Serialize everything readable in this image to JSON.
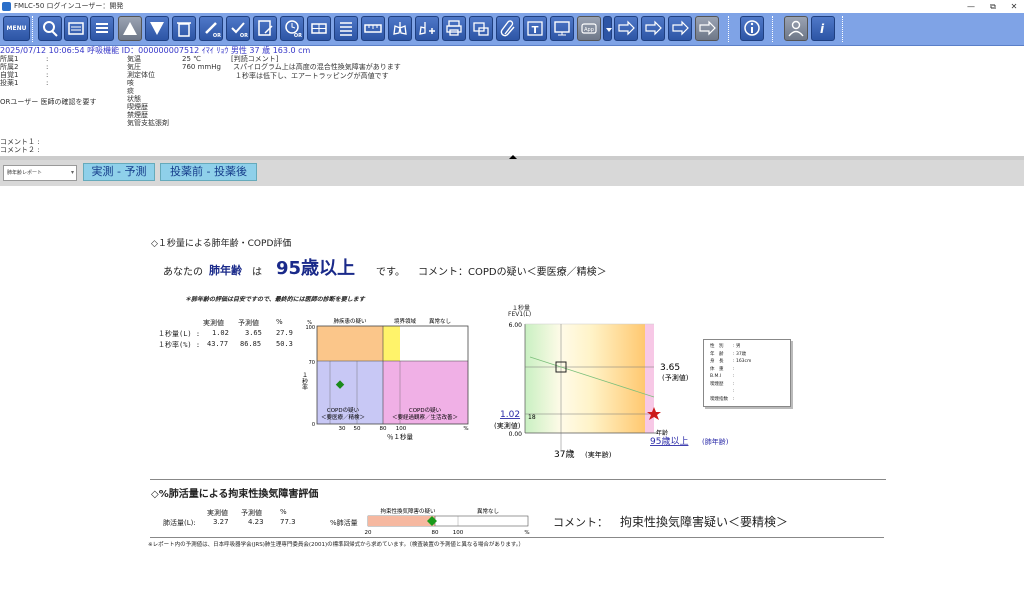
{
  "window": {
    "title": "FMLC-50 ログインユーザー：開発",
    "minimize": "—",
    "restore": "⧉",
    "close": "✕"
  },
  "toolbar": {
    "menu_label": "MENU"
  },
  "patient": {
    "infoline": "2025/07/12 10:06:54 呼吸機能 ID：000000007512 ｲﾏｲ ﾘｮｳ 男性 37 歳 163.0 cm",
    "left_labels": [
      "所属1",
      "所属2",
      "自覚1",
      "投薬1"
    ],
    "left_colons": [
      ":",
      ":",
      ":",
      ":"
    ],
    "or_user": "ORユーザー 医師の確認を要す",
    "mid_labels": [
      "気温",
      "気圧",
      "測定体位",
      "咳",
      "痰",
      "状態",
      "喫煙歴",
      "禁煙歴",
      "気管支拡張剤"
    ],
    "temp": "25 ℃",
    "pressure": "760 mmHg",
    "judge_title": "[判読コメント]",
    "judge_line1": "スパイログラム上は高度の混合性換気障害があります",
    "judge_line2": "１秒率は低下し、エアートラッピングが高値です",
    "comment1": "コメント１ :",
    "comment2": "コメント２ :"
  },
  "tabs": {
    "report_select": "肺年齢レポート",
    "tab1": "実測 - 予測",
    "tab2": "投薬前 - 投薬後"
  },
  "report": {
    "section1_title": "◇１秒量による肺年齢・COPD評価",
    "lung_age_prefix": "あなたの",
    "lung_age_label": "肺年齢",
    "lung_age_ha": "は",
    "lung_age_value": "95歳以上",
    "lung_age_suffix": "です。",
    "lung_age_comment": "コメント：COPDの疑い＜要医療／精検＞",
    "note": "＊肺年齢の評価は目安ですので、最終的には医師の診断を要します",
    "table_headers": [
      "実測値",
      "予測値",
      "%"
    ],
    "table_rows": [
      {
        "label": "１秒量(L) :",
        "values": [
          "1.02",
          "3.65",
          "27.9"
        ]
      },
      {
        "label": "１秒率(%) :",
        "values": [
          "43.77",
          "86.85",
          "50.3"
        ]
      }
    ],
    "quad": {
      "y_axis_title": "１秒率",
      "y_axis_unit": "%",
      "y_ticks": [
        "100",
        "70",
        "0"
      ],
      "x_ticks": [
        "30",
        "50",
        "80",
        "100",
        "%"
      ],
      "x_title": "％１秒量",
      "top_labels": [
        "肺疾患の疑い",
        "境界領域",
        "異常なし"
      ],
      "q_low_left": [
        "COPDの疑い",
        "＜要医療／精検＞"
      ],
      "q_low_right": [
        "COPDの疑い",
        "＜要経過観察／生活改善＞"
      ],
      "colors": {
        "orange": "#fbc68a",
        "yellow": "#fff36a",
        "blue": "#c8c8f5",
        "pink": "#f0b0e6"
      },
      "point": {
        "pct_fev1": 27.9,
        "fev1_ratio": 43.77
      }
    },
    "age_chart": {
      "y_title": "１秒量",
      "y_unit": "FEV1(L)",
      "y_top": "6.00",
      "y_bottom": "0.00",
      "pred_value": "3.65",
      "pred_label": "(予測値)",
      "meas_value": "1.02",
      "meas_label": "(実測値)",
      "age_label": "年齢",
      "lung_age_text": "95歳以上",
      "lung_age_suffix": "(肺年齢)",
      "real_age": "37歳",
      "real_age_suffix": "(実年齢)",
      "tick_value": "18"
    },
    "profile": {
      "rows": [
        {
          "k": "性　別",
          "v": "男"
        },
        {
          "k": "年　齢",
          "v": "37歳"
        },
        {
          "k": "身　長",
          "v": "163cm"
        },
        {
          "k": "体　重",
          "v": ""
        },
        {
          "k": "B.M.I",
          "v": ""
        },
        {
          "k": "喫煙歴",
          "v": ""
        },
        {
          "k": "",
          "v": ""
        },
        {
          "k": "喫煙指数",
          "v": ""
        }
      ]
    },
    "section2_title": "◇%肺活量による拘束性換気障害評価",
    "vc_headers": [
      "実測値",
      "予測値",
      "%"
    ],
    "vc_row_label": "肺活量(L):",
    "vc_values": [
      "3.27",
      "4.23",
      "77.3"
    ],
    "vc_bar_label": "%肺活量",
    "vc_top_labels": [
      "拘束性換気障害の疑い",
      "異常なし"
    ],
    "vc_ticks": [
      "20",
      "80",
      "100",
      "%"
    ],
    "vc_point": 77.3,
    "vc_comment_prefix": "コメント：",
    "vc_comment": "拘束性換気障害疑い＜要精検＞",
    "footer": "※レポート内の予測値は、日本呼吸器学会(JRS)肺生理専門委員会(2001)の標準回帰式から求めています。（検査装置の予測値と異なる場合があります。）"
  }
}
